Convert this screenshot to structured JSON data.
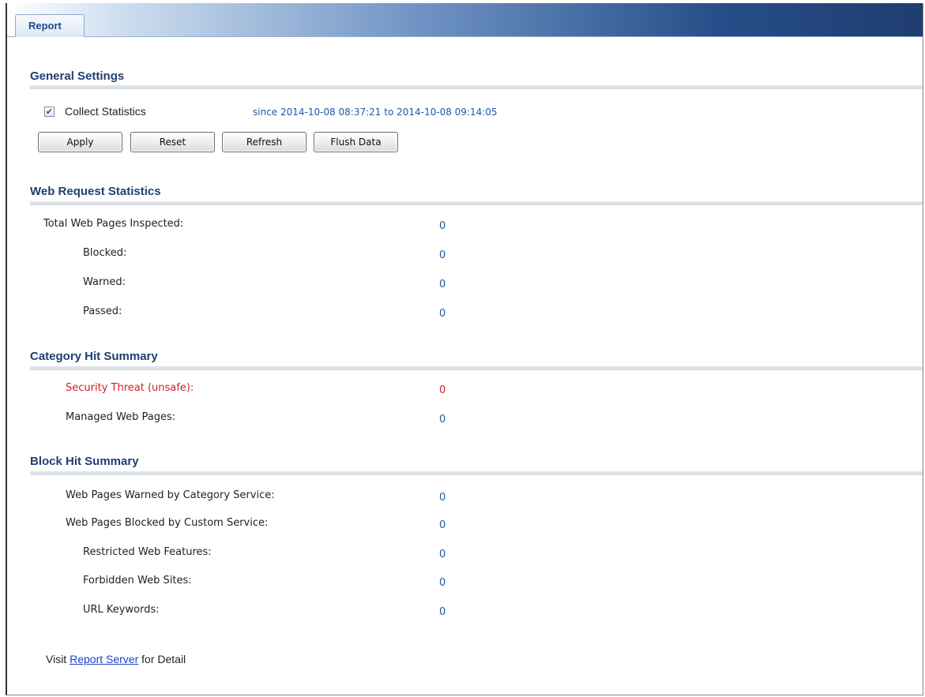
{
  "tab": {
    "label": "Report"
  },
  "general": {
    "title": "General Settings",
    "collect_label": "Collect Statistics",
    "collect_checked": true,
    "since_text": "since 2014-10-08 08:37:21 to 2014-10-08 09:14:05",
    "buttons": {
      "apply": "Apply",
      "reset": "Reset",
      "refresh": "Refresh",
      "flush": "Flush Data"
    }
  },
  "web_request": {
    "title": "Web Request Statistics",
    "rows": [
      {
        "label": "Total Web Pages Inspected:",
        "value": "0"
      },
      {
        "label": "Blocked:",
        "value": "0"
      },
      {
        "label": "Warned:",
        "value": "0"
      },
      {
        "label": "Passed:",
        "value": "0"
      }
    ]
  },
  "category": {
    "title": "Category Hit Summary",
    "rows": [
      {
        "label": "Security Threat (unsafe):",
        "value": "0"
      },
      {
        "label": "Managed Web Pages:",
        "value": "0"
      }
    ]
  },
  "block": {
    "title": "Block Hit Summary",
    "rows": [
      {
        "label": "Web Pages Warned by Category Service:",
        "value": "0"
      },
      {
        "label": "Web Pages Blocked by Custom Service:",
        "value": "0"
      },
      {
        "label": "Restricted Web Features:",
        "value": "0"
      },
      {
        "label": "Forbidden Web Sites:",
        "value": "0"
      },
      {
        "label": "URL Keywords:",
        "value": "0"
      }
    ]
  },
  "footer": {
    "prefix": "Visit",
    "link": "Report Server",
    "suffix": "for Detail"
  },
  "colors": {
    "accent": "#1d58a8",
    "title": "#203f72",
    "alert": "#d21f1f",
    "link": "#1a3fcb"
  }
}
